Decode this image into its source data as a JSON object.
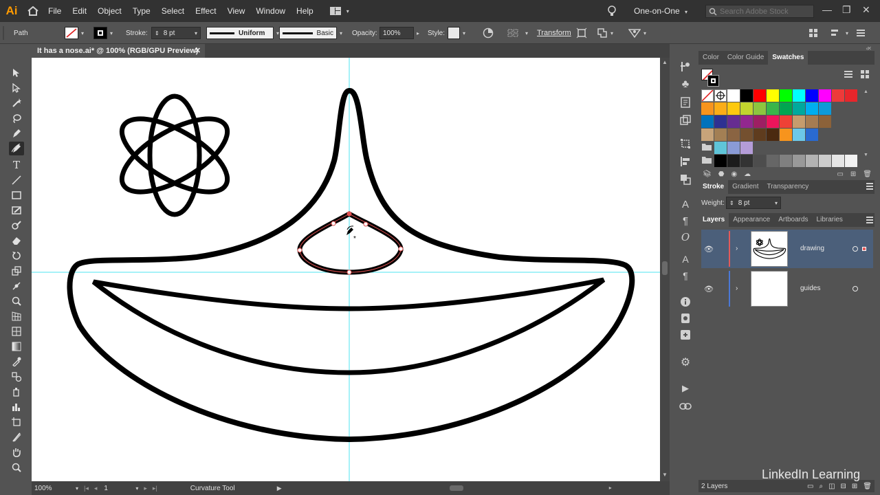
{
  "app": {
    "logo": "Ai"
  },
  "menu": [
    "File",
    "Edit",
    "Object",
    "Type",
    "Select",
    "Effect",
    "View",
    "Window",
    "Help"
  ],
  "workspace": "One-on-One",
  "search": {
    "placeholder": "Search Adobe Stock"
  },
  "control": {
    "selection_type": "Path",
    "stroke_label": "Stroke:",
    "stroke_weight": "8 pt",
    "profile_uniform": "Uniform",
    "brush_basic": "Basic",
    "opacity_label": "Opacity:",
    "opacity_value": "100%",
    "style_label": "Style:",
    "transform_label": "Transform"
  },
  "document": {
    "tab_title": "It has a nose.ai* @ 100% (RGB/GPU Preview)",
    "close": "✕"
  },
  "status": {
    "zoom": "100%",
    "artboard": "1",
    "tool": "Curvature Tool"
  },
  "panels": {
    "top_tabs": [
      "Color",
      "Color Guide",
      "Swatches"
    ],
    "stroke_tabs": [
      "Stroke",
      "Gradient",
      "Transparency"
    ],
    "weight_label": "Weight:",
    "weight_value": "8 pt",
    "layers_tabs": [
      "Layers",
      "Appearance",
      "Artboards",
      "Libraries"
    ],
    "layers": [
      {
        "name": "drawing",
        "color": "#e35a5a"
      },
      {
        "name": "guides",
        "color": "#4a78d6"
      }
    ],
    "layer_count": "2 Layers"
  },
  "swatch_colors": [
    [
      "#ffffff",
      "#000000",
      "#ff0000",
      "#ffff00",
      "#00ff00",
      "#00ffff",
      "#0000ff",
      "#ff00ff",
      "#ee3a3a",
      "#e8262b"
    ],
    [
      "#f7941d",
      "#fbad17",
      "#fdc90f",
      "#c2d52e",
      "#8dc63f",
      "#39b54a",
      "#00a651",
      "#00a99d",
      "#00aeef",
      "#0e9ad8"
    ],
    [
      "#0072bc",
      "#2e3192",
      "#662d91",
      "#92278f",
      "#9e1f63",
      "#ed145b",
      "#ef4136",
      "#c69c6d",
      "#a67c52",
      "#8c6239"
    ],
    [
      "#c7a47a",
      "#a37f54",
      "#8a6442",
      "#74502f",
      "#5f3c1e",
      "#4b2a10",
      "#f7941d",
      "#6cc8e8",
      "#2a6ad0"
    ],
    [
      "#5fc4d8",
      "#8a9bd6",
      "#b49cd8"
    ],
    [
      "#000000",
      "#1c1c1c",
      "#333333",
      "#4d4d4d",
      "#666666",
      "#808080",
      "#999999",
      "#b3b3b3",
      "#cccccc",
      "#e6e6e6",
      "#f2f2f2"
    ]
  ],
  "brand": {
    "accent": "#ff9a00",
    "guide": "#4de6f0",
    "selection": "#e05050"
  },
  "watermark": "LinkedIn Learning"
}
